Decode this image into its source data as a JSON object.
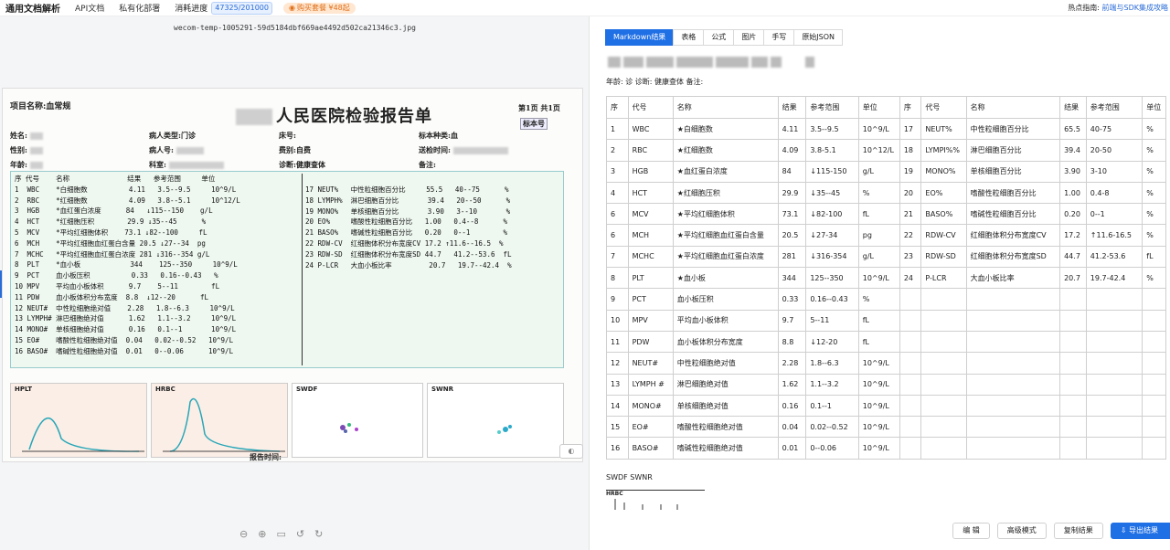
{
  "topbar": {
    "brand": "通用文档解析",
    "nav": [
      "API文档",
      "私有化部署"
    ],
    "usage_label": "消耗进度",
    "usage_value": "47325/201000",
    "buy_label": "购买套餐 ¥48起",
    "hotspot_label": "热点指南:",
    "hotspot_link": "前端与SDK集成攻略"
  },
  "left": {
    "filename": "wecom-temp-1005291-59d5184dbf669ae4492d502ca21346c3.jpg",
    "doc": {
      "project": "项目名称:血常规",
      "title": "人民医院检验报告单",
      "page": "第1页 共1页",
      "biaoben": "标本号",
      "name_label": "姓名:",
      "gender_label": "性别:",
      "age_label": "年龄:",
      "patient_type": "病人类型:门诊",
      "patient_no": "病人号:",
      "dept": "科室:",
      "bed": "床号:",
      "fee": "费别:自费",
      "diagnosis": "诊断:健康查体",
      "sample_type": "标本种类:血",
      "send_time": "送检时间:",
      "remark": "备注:",
      "left_col": "序 代号    名称              结果   参考范围     单位\n1  WBC    *白细胞数          4.11   3.5--9.5     10^9/L\n2  RBC    *红细胞数          4.09   3.8--5.1     10^12/L\n3  HGB    *血红蛋白浓度      84   ↓115--150    g/L\n4  HCT    *红细胞压积        29.9 ↓35--45      %\n5  MCV    *平均红细胞体积    73.1 ↓82--100     fL\n6  MCH    *平均红细胞血红蛋白含量 20.5 ↓27--34  pg\n7  MCHC   *平均红细胞血红蛋白浓度 281 ↓316--354 g/L\n8  PLT    *血小板            344    125--350     10^9/L\n9  PCT    血小板压积          0.33   0.16--0.43   %\n10 MPV    平均血小板体积      9.7    5--11        fL\n11 PDW    血小板体积分布宽度  8.8  ↓12--20      fL\n12 NEUT#  中性粒细胞绝对值    2.28   1.8--6.3     10^9/L\n13 LYMPH# 淋巴细胞绝对值      1.62   1.1--3.2     10^9/L\n14 MONO#  单核细胞绝对值      0.16   0.1--1       10^9/L\n15 EO#    嗜酸性粒细胞绝对值  0.04   0.02--0.52   10^9/L\n16 BASO#  嗜碱性粒细胞绝对值  0.01   0--0.06      10^9/L",
      "right_col": "17 NEUT%   中性粒细胞百分比     55.5   40--75      %\n18 LYMPH%  淋巴细胞百分比       39.4   20--50      %\n19 MONO%   单核细胞百分比       3.90   3--10       %\n20 EO%     嗜酸性粒细胞百分比   1.00   0.4--8      %\n21 BASO%   嗜碱性粒细胞百分比   0.20   0--1        %\n22 RDW-CV  红细胞体积分布宽度CV 17.2 ↑11.6--16.5  %\n23 RDW-SD  红细胞体积分布宽度SD 44.7   41.2--53.6  fL\n24 P-LCR   大血小板比率         20.7   19.7--42.4  %",
      "hist_labels": [
        "HPLT",
        "HRBC",
        "SWDF",
        "SWNR"
      ],
      "report_time": "报告时间:"
    },
    "zoom_icons": [
      "⊖",
      "⊕",
      "▭",
      "↺",
      "↻"
    ]
  },
  "right": {
    "tabs": [
      "Markdown结果",
      "表格",
      "公式",
      "图片",
      "手写",
      "原始JSON"
    ],
    "meta": "年龄:            诊 诊断: 健康查体 备注:",
    "headers": [
      "序",
      "代号",
      "名称",
      "结果",
      "参考范围",
      "单位",
      "序",
      "代号",
      "名称",
      "结果",
      "参考范围",
      "单位"
    ],
    "rows": [
      [
        "1",
        "WBC",
        "★白细胞数",
        "4.11",
        "3.5--9.5",
        "10^9/L",
        "17",
        "NEUT%",
        "中性粒细胞百分比",
        "65.5",
        "40-75",
        "%"
      ],
      [
        "2",
        "RBC",
        "★红细胞数",
        "4.09",
        "3.8-5.1",
        "10^12/L",
        "18",
        "LYMPI%%",
        "淋巴细胞百分比",
        "39.4",
        "20-50",
        "%"
      ],
      [
        "3",
        "HGB",
        "★血红蛋白浓度",
        "84",
        "↓115-150",
        "g/L",
        "19",
        "MONO%",
        "单核细胞百分比",
        "3.90",
        "3-10",
        "%"
      ],
      [
        "4",
        "HCT",
        "★红细胞压积",
        "29.9",
        "↓35--45",
        "%",
        "20",
        "EO%",
        "嗜酸性粒细胞百分比",
        "1.00",
        "0.4-8",
        "%"
      ],
      [
        "6",
        "MCV",
        "★平均红细胞体积",
        "73.1",
        "↓82-100",
        "fL",
        "21",
        "BASO%",
        "嗜碱性粒细胞百分比",
        "0.20",
        "0--1",
        "%"
      ],
      [
        "6",
        "MCH",
        "★平均红细胞血红蛋白含量",
        "20.5",
        "↓27-34",
        "pg",
        "22",
        "RDW-CV",
        "红细胞体积分布宽度CV",
        "17.2",
        "↑11.6-16.5",
        "%"
      ],
      [
        "7",
        "MCHC",
        "★平均红细胞血红蛋白浓度",
        "281",
        "↓316-354",
        "g/L",
        "23",
        "RDW-SD",
        "红细胞体积分布宽度SD",
        "44.7",
        "41.2-53.6",
        "fL"
      ],
      [
        "8",
        "PLT",
        "★血小板",
        "344",
        "125--350",
        "10^9/L",
        "24",
        "P-LCR",
        "大血小板比率",
        "20.7",
        "19.7-42.4",
        "%"
      ],
      [
        "9",
        "PCT",
        "血小板压积",
        "0.33",
        "0.16--0.43",
        "%",
        "",
        "",
        "",
        "",
        "",
        ""
      ],
      [
        "10",
        "MPV",
        "平均血小板体积",
        "9.7",
        "5--11",
        "fL",
        "",
        "",
        "",
        "",
        "",
        ""
      ],
      [
        "11",
        "PDW",
        "血小板体积分布宽度",
        "8.8",
        "↓12-20",
        "fL",
        "",
        "",
        "",
        "",
        "",
        ""
      ],
      [
        "12",
        "NEUT#",
        "中性粒细胞绝对值",
        "2.28",
        "1.8--6.3",
        "10^9/L",
        "",
        "",
        "",
        "",
        "",
        ""
      ],
      [
        "13",
        "LYMPH #",
        "淋巴细胞绝对值",
        "1.62",
        "1.1--3.2",
        "10^9/L",
        "",
        "",
        "",
        "",
        "",
        ""
      ],
      [
        "14",
        "MONO#",
        "单核细胞绝对值",
        "0.16",
        "0.1--1",
        "10^9/L",
        "",
        "",
        "",
        "",
        "",
        ""
      ],
      [
        "15",
        "EO#",
        "嗜酸性粒细胞绝对值",
        "0.04",
        "0.02--0.52",
        "10^9/L",
        "",
        "",
        "",
        "",
        "",
        ""
      ],
      [
        "16",
        "BASO#",
        "嗜碱性粒细胞绝对值",
        "0.01",
        "0--0.06",
        "10^9/L",
        "",
        "",
        "",
        "",
        "",
        ""
      ]
    ],
    "swdf_label": "SWDF SWNR",
    "small_chart_label": "HRBC",
    "buttons": {
      "edit": "编 辑",
      "advanced": "高级模式",
      "copy": "复制结果",
      "export": "导出结果"
    }
  },
  "colors": {
    "accent": "#1f6fe5",
    "usage_bg": "#e6f0ff",
    "buy_text": "#e0701a"
  }
}
